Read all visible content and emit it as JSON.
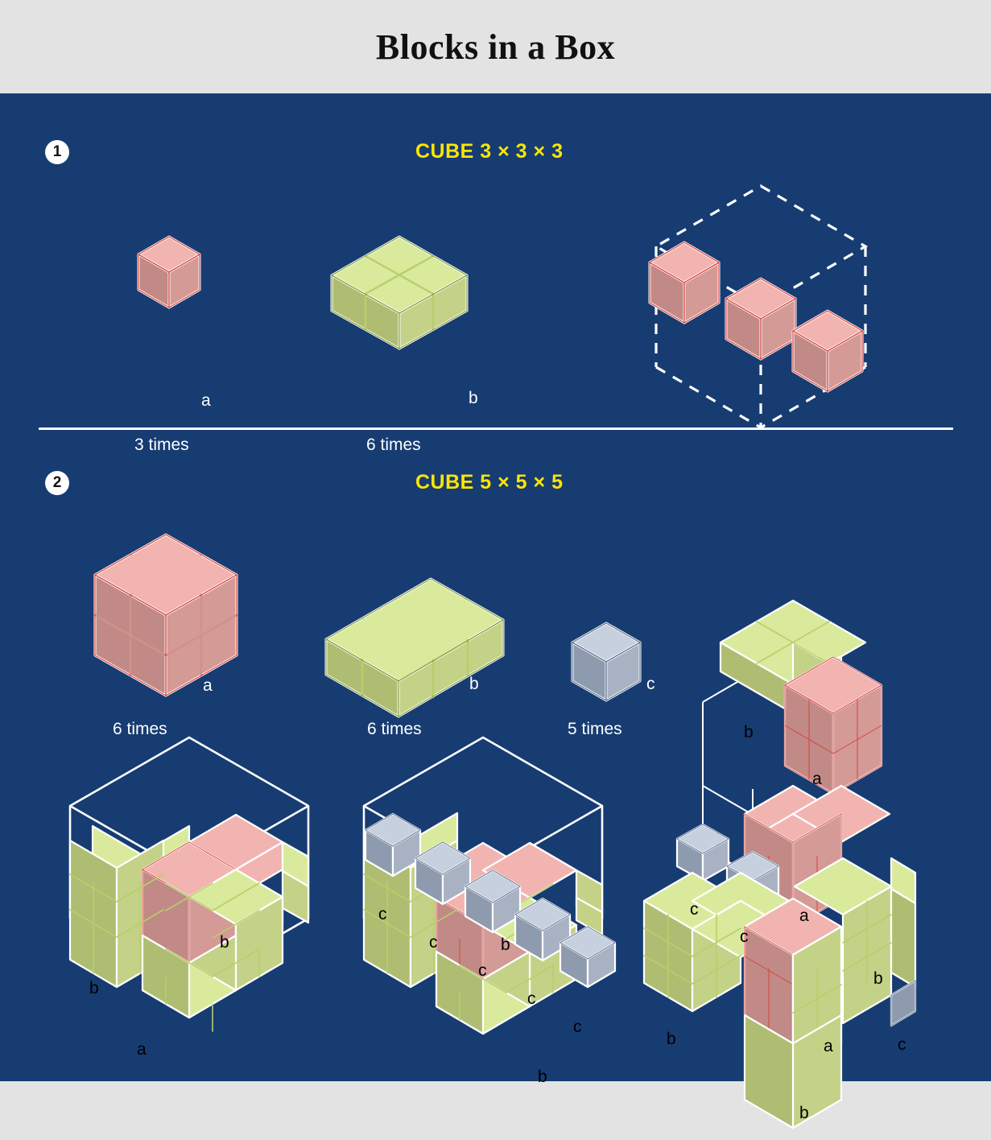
{
  "header": {
    "title": "Blocks in a Box"
  },
  "colors": {
    "background": "#e3e3e3",
    "canvas": "#173c72",
    "accent_yellow": "#ffe500",
    "pink_top": "#f2b4b0",
    "pink_left": "#c18a86",
    "pink_right": "#d49a96",
    "pink_edge": "#d9433f",
    "green_top": "#d9ea9c",
    "green_left": "#aebd72",
    "green_right": "#c3d287",
    "green_edge": "#7f9a33",
    "gray_top": "#c7d0de",
    "gray_left": "#8e9aae",
    "gray_right": "#a8b2c3",
    "gray_edge": "#5d7290",
    "wire": "#ffffff",
    "label_light": "#ffffff",
    "label_dark": "#000000"
  },
  "sections": [
    {
      "badge": "1",
      "title": "CUBE 3 × 3 × 3",
      "pieces": [
        {
          "label": "a",
          "count_text": "3 times",
          "color": "pink",
          "dims": "1 × 1 × 1"
        },
        {
          "label": "b",
          "count_text": "6 times",
          "color": "green",
          "dims": "2 × 2 × 1"
        }
      ],
      "solution": {
        "wireframe": "3 × 3 × 3 dashed cube",
        "visible_blocks": 3,
        "block_color": "pink"
      }
    },
    {
      "badge": "2",
      "title": "CUBE 5 × 5 × 5",
      "pieces": [
        {
          "label": "a",
          "count_text": "6 times",
          "color": "pink",
          "dims": "2 × 2 × 2"
        },
        {
          "label": "b",
          "count_text": "6 times",
          "color": "green",
          "dims": "3 × 2 × 1"
        },
        {
          "label": "c",
          "count_text": "5 times",
          "color": "gray",
          "dims": "1 × 1 × 1"
        }
      ],
      "solutions": [
        {
          "name": "layer-1",
          "labels": [
            "b",
            "b",
            "a"
          ]
        },
        {
          "name": "layer-2",
          "labels": [
            "c",
            "c",
            "c",
            "c",
            "c",
            "b",
            "b"
          ]
        },
        {
          "name": "layer-3",
          "labels": [
            "b",
            "a",
            "c",
            "c",
            "a",
            "b",
            "b",
            "a",
            "b",
            "c"
          ]
        }
      ]
    }
  ]
}
